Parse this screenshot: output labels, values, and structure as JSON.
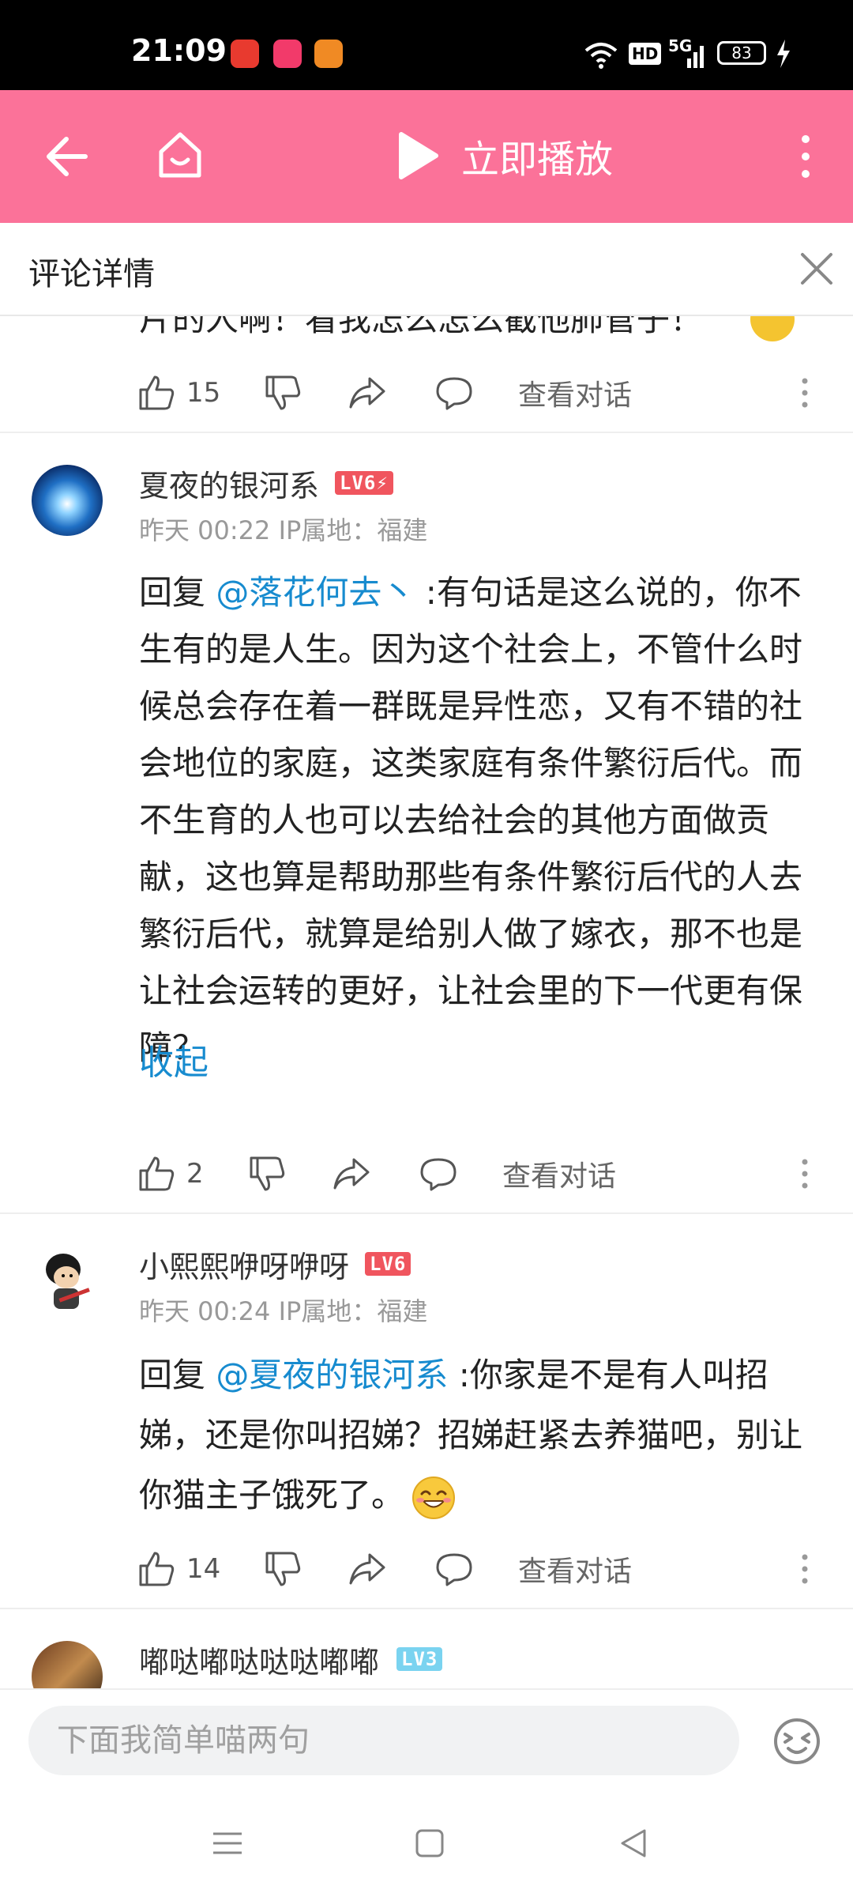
{
  "status_bar": {
    "time": "21:09",
    "battery": "83",
    "network": "5G",
    "hd": "HD",
    "icons": [
      "notification-app-icon",
      "notification-app-icon",
      "notification-app-icon",
      "wifi-icon",
      "signal-icon",
      "charging-icon"
    ]
  },
  "top_nav": {
    "play_label": "立即播放",
    "accent_color": "#fb7299"
  },
  "comment_header": {
    "title": "评论详情"
  },
  "partial_comment": {
    "text": "片的人啊！看我怎么怎么截他肺管子！",
    "likes": "15",
    "view_conversation": "查看对话"
  },
  "comments": [
    {
      "username": "夏夜的银河系",
      "level": "LV6⚡",
      "time": "昨天 00:22",
      "ip": "IP属地：福建",
      "reply_prefix": "回复 ",
      "mention": "@落花何去丶",
      "text": ":有句话是这么说的，你不生有的是人生。因为这个社会上，不管什么时候总会存在着一群既是异性恋，又有不错的社会地位的家庭，这类家庭有条件繁衍后代。而不生育的人也可以去给社会的其他方面做贡献，这也算是帮助那些有条件繁衍后代的人去繁衍后代，就算是给别人做了嫁衣，那不也是让社会运转的更好，让社会里的下一代更有保障？",
      "collapse": "收起",
      "likes": "2",
      "view_conversation": "查看对话"
    },
    {
      "username": "小熙熙咿呀咿呀",
      "level": "LV6",
      "time": "昨天 00:24",
      "ip": "IP属地：福建",
      "reply_prefix": "回复 ",
      "mention": "@夏夜的银河系",
      "text": ":你家是不是有人叫招娣，还是你叫招娣？招娣赶紧去养猫吧，别让你猫主子饿死了。",
      "likes": "14",
      "view_conversation": "查看对话"
    },
    {
      "username": "嘟哒嘟哒哒哒嘟嘟",
      "level": "LV3"
    }
  ],
  "bottom_bar": {
    "input_placeholder": "下面我简单喵两句"
  },
  "colors": {
    "mention": "#178bcf",
    "lv6": "#f0555e",
    "lv3": "#7ad3f0"
  }
}
